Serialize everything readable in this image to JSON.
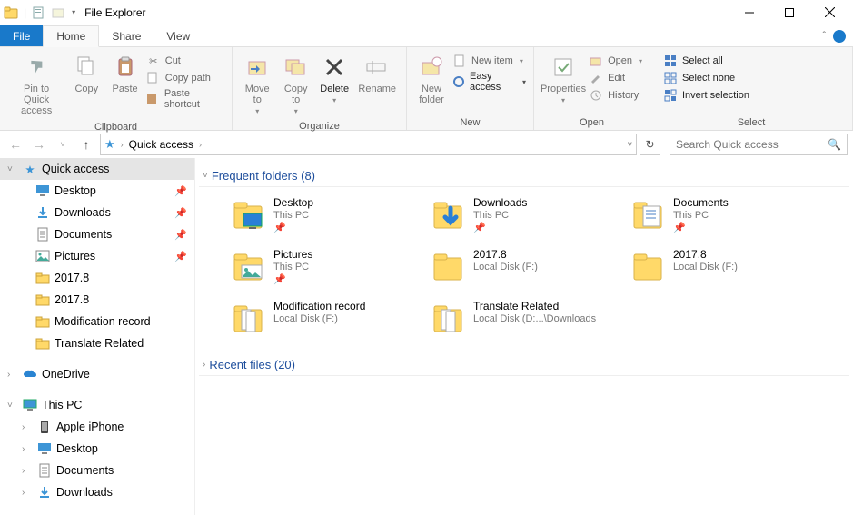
{
  "window": {
    "title": "File Explorer"
  },
  "tabs": {
    "file": "File",
    "home": "Home",
    "share": "Share",
    "view": "View"
  },
  "ribbon": {
    "clipboard": {
      "label": "Clipboard",
      "pin": "Pin to Quick\naccess",
      "copy": "Copy",
      "paste": "Paste",
      "cut": "Cut",
      "copypath": "Copy path",
      "pasteshortcut": "Paste shortcut"
    },
    "organize": {
      "label": "Organize",
      "moveto": "Move\nto",
      "copyto": "Copy\nto",
      "delete": "Delete",
      "rename": "Rename"
    },
    "new": {
      "label": "New",
      "newfolder": "New\nfolder",
      "newitem": "New item",
      "easyaccess": "Easy access"
    },
    "open": {
      "label": "Open",
      "properties": "Properties",
      "open": "Open",
      "edit": "Edit",
      "history": "History"
    },
    "select": {
      "label": "Select",
      "selectall": "Select all",
      "selectnone": "Select none",
      "invert": "Invert selection"
    }
  },
  "address": {
    "current": "Quick access",
    "search_placeholder": "Search Quick access"
  },
  "sidebar": {
    "quickaccess": "Quick access",
    "items": [
      {
        "label": "Desktop",
        "pin": true,
        "icon": "desktop"
      },
      {
        "label": "Downloads",
        "pin": true,
        "icon": "download"
      },
      {
        "label": "Documents",
        "pin": true,
        "icon": "document"
      },
      {
        "label": "Pictures",
        "pin": true,
        "icon": "picture"
      },
      {
        "label": "2017.8",
        "pin": false,
        "icon": "folder"
      },
      {
        "label": "2017.8",
        "pin": false,
        "icon": "folder"
      },
      {
        "label": "Modification record",
        "pin": false,
        "icon": "folder"
      },
      {
        "label": "Translate Related",
        "pin": false,
        "icon": "folder"
      }
    ],
    "onedrive": "OneDrive",
    "thispc": "This PC",
    "pcitems": [
      {
        "label": "Apple iPhone",
        "icon": "phone"
      },
      {
        "label": "Desktop",
        "icon": "desktop"
      },
      {
        "label": "Documents",
        "icon": "document"
      },
      {
        "label": "Downloads",
        "icon": "download"
      }
    ]
  },
  "main": {
    "frequent": {
      "title": "Frequent folders (8)",
      "items": [
        {
          "name": "Desktop",
          "sub": "This PC",
          "pin": true,
          "icon": "desktop-folder"
        },
        {
          "name": "Downloads",
          "sub": "This PC",
          "pin": true,
          "icon": "download-folder"
        },
        {
          "name": "Documents",
          "sub": "This PC",
          "pin": true,
          "icon": "document-folder"
        },
        {
          "name": "Pictures",
          "sub": "This PC",
          "pin": true,
          "icon": "pictures-folder"
        },
        {
          "name": "2017.8",
          "sub": "Local Disk (F:)",
          "pin": false,
          "icon": "folder"
        },
        {
          "name": "2017.8",
          "sub": "Local Disk (F:)",
          "pin": false,
          "icon": "folder"
        },
        {
          "name": "Modification record",
          "sub": "Local Disk (F:)",
          "pin": false,
          "icon": "folder-docs"
        },
        {
          "name": "Translate Related",
          "sub": "Local Disk (D:...\\Downloads",
          "pin": false,
          "icon": "folder-docs"
        }
      ]
    },
    "recent": {
      "title": "Recent files (20)"
    }
  }
}
